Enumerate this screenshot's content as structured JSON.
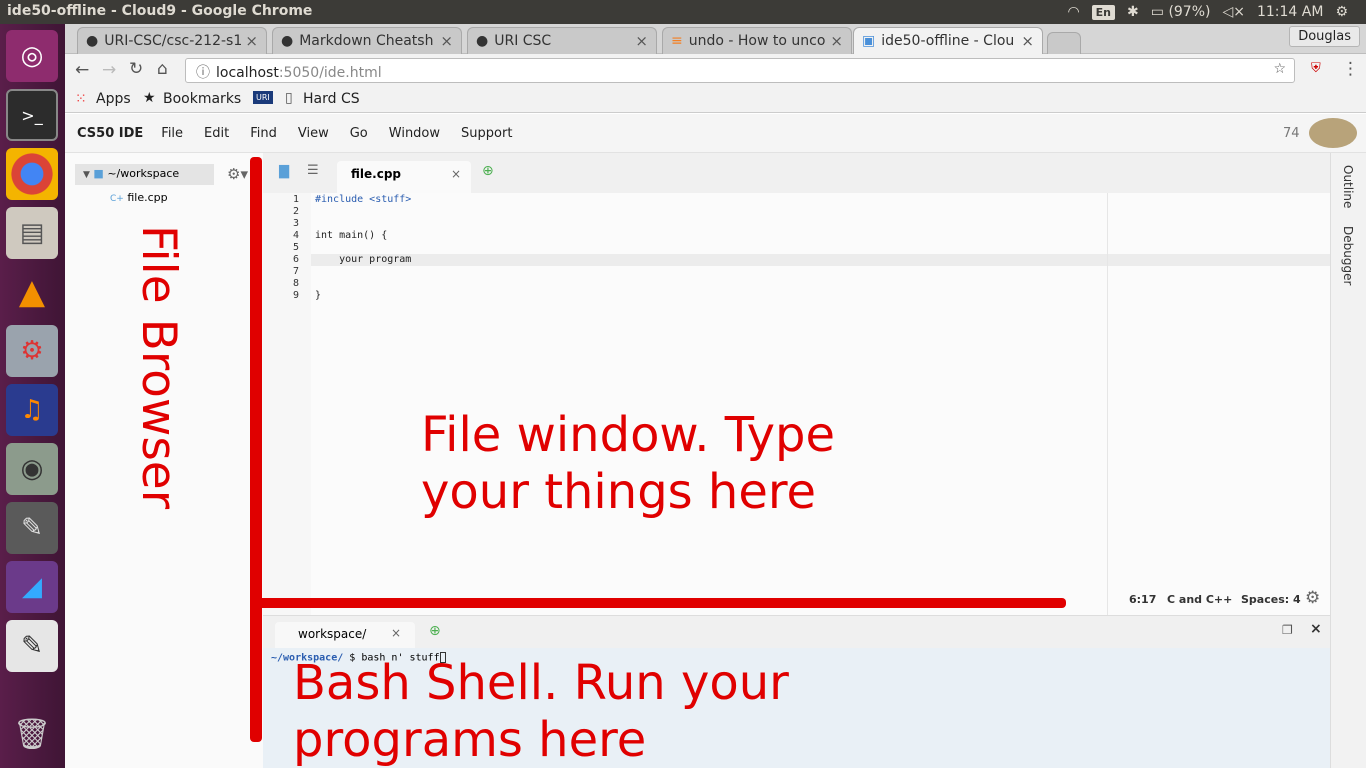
{
  "window_title": "ide50-offline - Cloud9 - Google Chrome",
  "tray": {
    "lang": "En",
    "battery": "(97%)",
    "time": "11:14 AM"
  },
  "tabs": [
    {
      "label": "URI-CSC/csc-212-s1"
    },
    {
      "label": "Markdown Cheatsh"
    },
    {
      "label": "URI CSC"
    },
    {
      "label": "undo - How to unco"
    },
    {
      "label": "ide50-offline - Clou"
    }
  ],
  "user": "Douglas",
  "url": {
    "host": "localhost",
    "rest": ":5050/ide.html"
  },
  "bookmarks": {
    "apps": "Apps",
    "bookmarks": "Bookmarks",
    "hardcs": "Hard CS"
  },
  "menubar": {
    "brand": "CS50 IDE",
    "items": [
      "File",
      "Edit",
      "Find",
      "View",
      "Go",
      "Window",
      "Support"
    ],
    "count": "74"
  },
  "filetree": {
    "root": "~/workspace",
    "file": "file.cpp"
  },
  "editor": {
    "tab": "file.cpp",
    "lines": [
      "#include <stuff>",
      "",
      "int main() {",
      "",
      "    your program",
      "",
      "",
      "}",
      ""
    ],
    "line_numbers": [
      "1",
      "2",
      "3",
      "4",
      "5",
      "6",
      "7",
      "8",
      "9"
    ]
  },
  "status": {
    "pos": "6:17",
    "lang": "C and C++",
    "spaces": "Spaces: 4"
  },
  "right_panels": [
    "Outline",
    "Debugger"
  ],
  "terminal": {
    "tab": "workspace/",
    "prompt": "~/workspace/",
    "cmd": "$ bash n' stuff"
  },
  "annotations": {
    "file_browser": "File Browser",
    "file_window_1": "File window. Type",
    "file_window_2": "your things here",
    "bash_1": "Bash Shell. Run your",
    "bash_2": "programs here"
  },
  "colors": {
    "annotation": "#e00000",
    "launcher": "#4a1a3e"
  }
}
